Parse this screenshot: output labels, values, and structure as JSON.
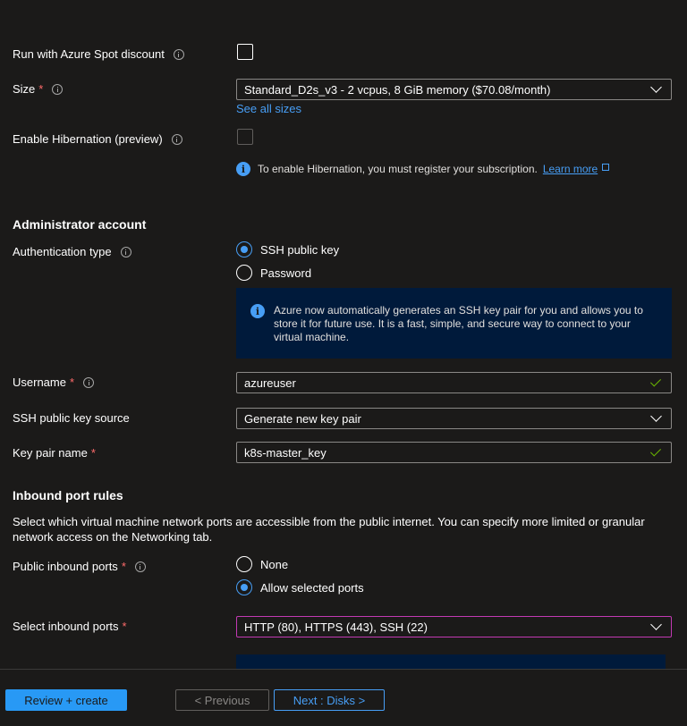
{
  "fields": {
    "spot_label": "Run with Azure Spot discount",
    "size_label": "Size",
    "size_required": "*",
    "size_value": "Standard_D2s_v3 - 2 vcpus, 8 GiB memory ($70.08/month)",
    "see_all_sizes": "See all sizes",
    "hibernation_label": "Enable Hibernation (preview)",
    "hibernation_notice": "To enable Hibernation, you must register your subscription.",
    "learn_more": "Learn more"
  },
  "admin": {
    "title": "Administrator account",
    "auth_label": "Authentication type",
    "auth_options": [
      "SSH public key",
      "Password"
    ],
    "auth_selected": "SSH public key",
    "ssh_info": "Azure now automatically generates an SSH key pair for you and allows you to store it for future use. It is a fast, simple, and secure way to connect to your virtual machine.",
    "username_label": "Username",
    "username_required": "*",
    "username_value": "azureuser",
    "key_source_label": "SSH public key source",
    "key_source_value": "Generate new key pair",
    "key_pair_label": "Key pair name",
    "key_pair_required": "*",
    "key_pair_value": "k8s-master_key"
  },
  "inbound": {
    "title": "Inbound port rules",
    "description": "Select which virtual machine network ports are accessible from the public internet. You can specify more limited or granular network access on the Networking tab.",
    "public_label": "Public inbound ports",
    "public_required": "*",
    "public_options": [
      "None",
      "Allow selected ports"
    ],
    "public_selected": "Allow selected ports",
    "select_label": "Select inbound ports",
    "select_required": "*",
    "select_value": "HTTP (80), HTTPS (443), SSH (22)"
  },
  "footer": {
    "review_create": "Review + create",
    "previous": "< Previous",
    "next": "Next : Disks >"
  },
  "colors": {
    "background": "#1b1a19",
    "accent": "#479ef5",
    "primary_button": "#2899f5",
    "required": "#ff6b6b",
    "valid_check": "#6bb700",
    "infobox_bg": "#001a3b"
  }
}
